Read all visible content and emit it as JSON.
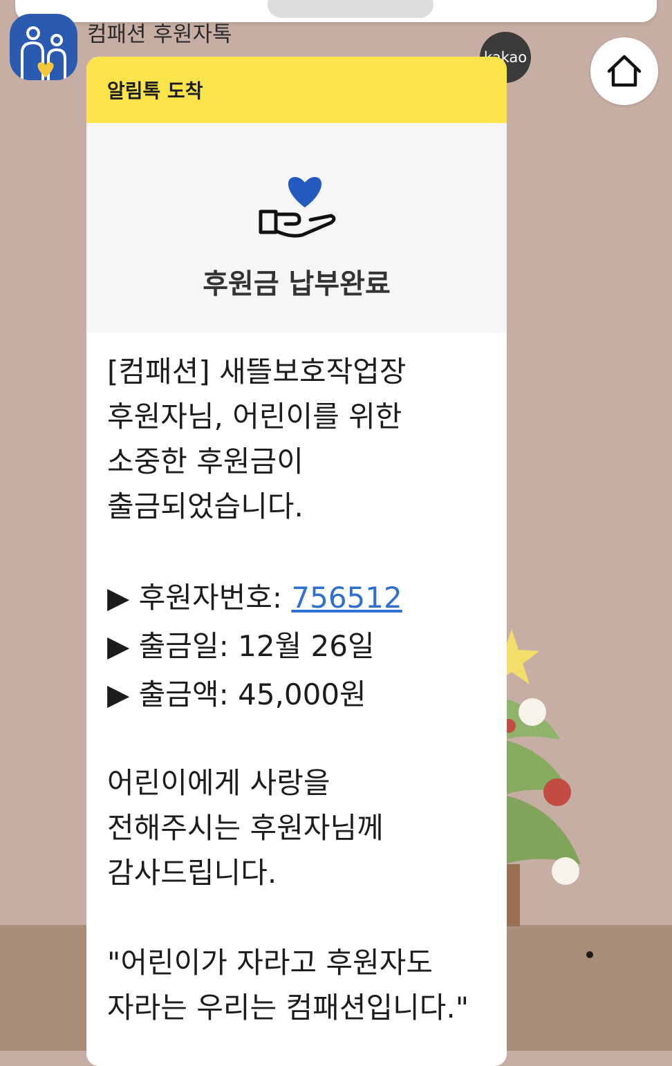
{
  "sender": {
    "name": "컴패션 후원자톡",
    "avatar_icon": "compassion-family-heart-icon",
    "brand_color": "#2a5bb0"
  },
  "kakao_badge": "kakao",
  "home_icon": "home-icon",
  "message": {
    "header": "알림톡 도착",
    "header_color": "#fbe44b",
    "hero_icon": "heart-hand-icon",
    "hero_title": "후원금 납부완료",
    "intro_lines": [
      "[컴패션] 새뜰보호작업장",
      "후원자님, 어린이를 위한",
      "소중한 후원금이",
      "출금되었습니다."
    ],
    "bullet": "▶",
    "donor_number_label": "후원자번호: ",
    "donor_number": "756512",
    "withdraw_date": "출금일: 12월 26일",
    "withdraw_amount": "출금액: 45,000원",
    "thanks_lines": [
      "어린이에게 사랑을",
      "전해주시는 후원자님께",
      "감사드립니다."
    ],
    "quote_lines": [
      "\"어린이가 자라고 후원자도",
      "자라는 우리는 컴패션입니다.\""
    ]
  }
}
